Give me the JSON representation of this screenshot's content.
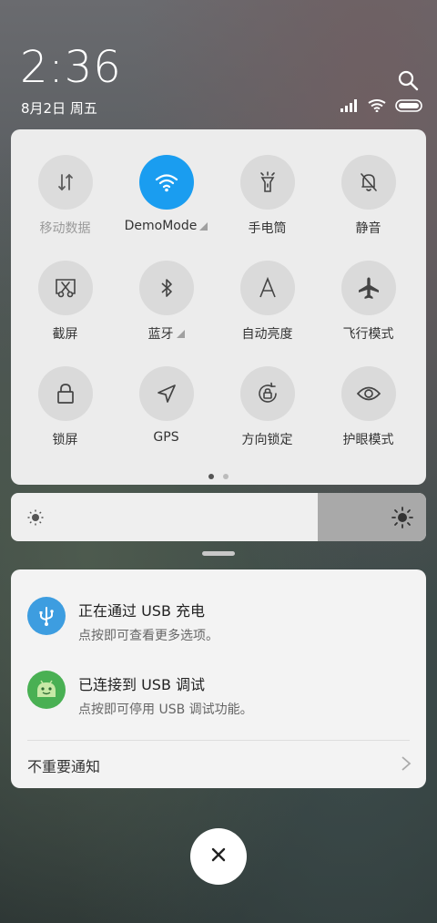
{
  "status": {
    "time": "2:36",
    "date": "8月2日 周五"
  },
  "quick_settings": [
    {
      "label": "移动数据",
      "icon": "mobile-data-icon",
      "active": false,
      "dimmed": true
    },
    {
      "label": "DemoMode",
      "icon": "wifi-icon",
      "active": true
    },
    {
      "label": "手电筒",
      "icon": "flashlight-icon",
      "active": false
    },
    {
      "label": "静音",
      "icon": "mute-bell-icon",
      "active": false
    },
    {
      "label": "截屏",
      "icon": "screenshot-icon",
      "active": false
    },
    {
      "label": "蓝牙",
      "icon": "bluetooth-icon",
      "active": false
    },
    {
      "label": "自动亮度",
      "icon": "auto-brightness-icon",
      "active": false
    },
    {
      "label": "飞行模式",
      "icon": "airplane-icon",
      "active": false
    },
    {
      "label": "锁屏",
      "icon": "lock-icon",
      "active": false
    },
    {
      "label": "GPS",
      "icon": "gps-icon",
      "active": false
    },
    {
      "label": "方向锁定",
      "icon": "rotation-lock-icon",
      "active": false
    },
    {
      "label": "护眼模式",
      "icon": "eye-icon",
      "active": false
    }
  ],
  "page_indicator": {
    "pages": 2,
    "current": 1
  },
  "brightness": {
    "level": 0.74
  },
  "notifications": [
    {
      "title": "正在通过  USB  充电",
      "subtitle": "点按即可查看更多选项。",
      "icon": "usb-icon",
      "color": "#3d9de0"
    },
    {
      "title": "已连接到  USB  调试",
      "subtitle": "点按即可停用 USB 调试功能。",
      "icon": "android-icon",
      "color": "#49b053"
    }
  ],
  "unimportant_label": "不重要通知",
  "colors": {
    "accent": "#1a9df0"
  }
}
